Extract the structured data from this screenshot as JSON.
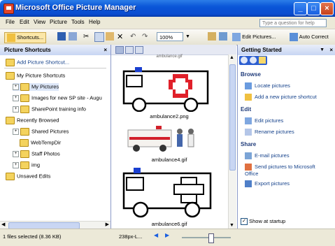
{
  "window": {
    "title": "Microsoft Office Picture Manager"
  },
  "menu": [
    "File",
    "Edit",
    "View",
    "Picture",
    "Tools",
    "Help"
  ],
  "help_placeholder": "Type a question for help",
  "toolbar": {
    "shortcuts": "Shortcuts...",
    "zoom": "100%",
    "edit_pictures": "Edit Pictures...",
    "auto_correct": "Auto Correct"
  },
  "left_pane": {
    "title": "Picture Shortcuts",
    "add_shortcut": "Add Picture Shortcut...",
    "items": [
      "My Picture Shortcuts",
      "My Pictures",
      "Images for new SP site - Augu",
      "SharePoint training info",
      "Recently Browsed",
      "Shared Pictures",
      "WebTempDir",
      "Staff Photos",
      "img",
      "Unsaved Edits"
    ]
  },
  "thumbnails": [
    "ambulance2.png",
    "ambulance4.gif",
    "ambulance6.gif"
  ],
  "top_caption": "ambulance.gif",
  "right_pane": {
    "title": "Getting Started",
    "browse": "Browse",
    "locate": "Locate pictures",
    "add_shortcut": "Add a new picture shortcut",
    "edit": "Edit",
    "edit_pictures": "Edit pictures",
    "rename": "Rename pictures",
    "share": "Share",
    "email": "E-mail pictures",
    "send": "Send pictures to Microsoft Office",
    "export": "Export pictures",
    "show_startup": "Show at startup"
  },
  "status": {
    "selected": "1 files selected (8.36 KB)",
    "size": "238px-L..."
  }
}
